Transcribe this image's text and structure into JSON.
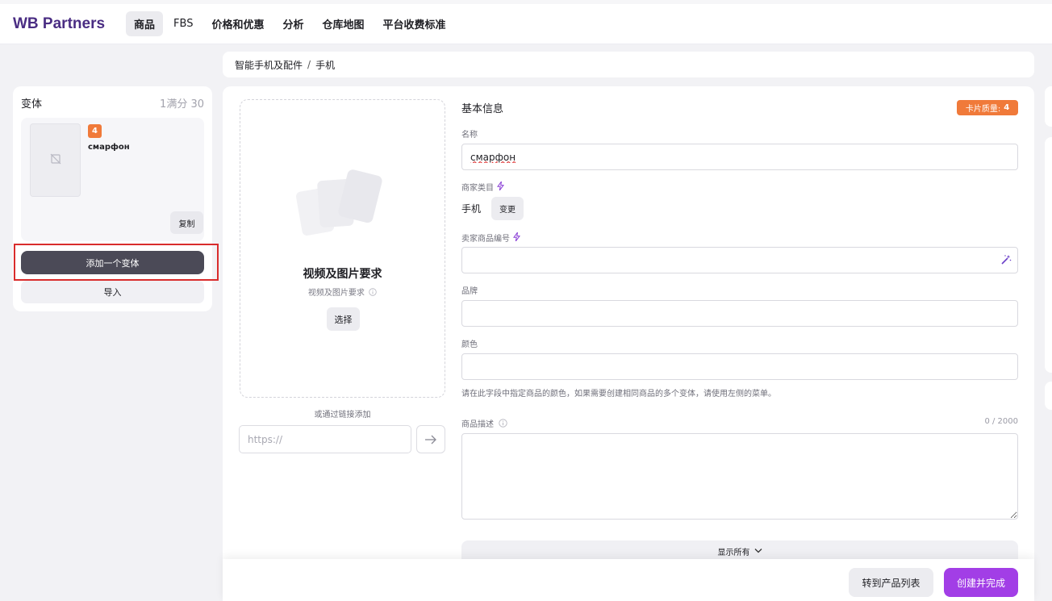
{
  "nav": {
    "logo": "WB Partners",
    "items": [
      "商品",
      "FBS",
      "价格和优惠",
      "分析",
      "仓库地图",
      "平台收费标准"
    ]
  },
  "breadcrumb": [
    "智能手机及配件",
    "手机"
  ],
  "variants": {
    "title": "变体",
    "count": "1满分 30",
    "card": {
      "badge": "4",
      "name": "смарфон",
      "copy_label": "复制"
    },
    "add_label": "添加一个变体",
    "import_label": "导入"
  },
  "media": {
    "title": "视频及图片要求",
    "subtitle": "视频及图片要求",
    "select_label": "选择",
    "link_label": "或通过链接添加",
    "url_placeholder": "https://"
  },
  "form": {
    "section_title": "基本信息",
    "quality_label": "卡片质量:",
    "quality_value": "4",
    "name_label": "名称",
    "name_value": "смарфон",
    "category_label": "商家类目",
    "category_value": "手机",
    "change_label": "变更",
    "vendor_code_label": "卖家商品编号",
    "vendor_code_value": "",
    "brand_label": "品牌",
    "brand_value": "",
    "color_label": "颜色",
    "color_value": "",
    "color_hint": "请在此字段中指定商品的颜色，如果需要创建相同商品的多个变体，请使用左侧的菜单。",
    "desc_label": "商品描述",
    "desc_counter": "0 / 2000",
    "show_all_label": "显示所有"
  },
  "footer": {
    "to_list_label": "转到产品列表",
    "create_label": "创建并完成"
  },
  "colors": {
    "brand": "#4a2d83",
    "accent": "#a23ee6",
    "badge": "#f07a3a",
    "highlight_box": "#d92c2c"
  },
  "icons": [
    "no-image-icon",
    "image-stack-icon",
    "info-icon",
    "bolt-icon",
    "magic-wand-icon",
    "arrow-right-icon",
    "chevron-down-icon"
  ]
}
